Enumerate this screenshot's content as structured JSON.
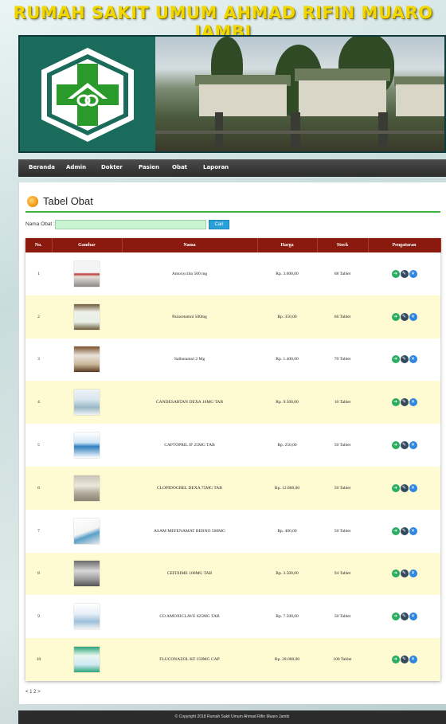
{
  "site": {
    "title": "RUMAH SAKIT UMUM AHMAD RIFIN MUARO JAMBI"
  },
  "nav": {
    "items": [
      "Beranda",
      "Admin",
      "Dokter",
      "Pasien",
      "Obat",
      "Laporan"
    ]
  },
  "page": {
    "section_title": "Tabel Obat"
  },
  "search": {
    "label": "Nama Obat :",
    "value": "",
    "button_label": "Cari"
  },
  "table": {
    "headers": [
      "No.",
      "Gambar",
      "Nama",
      "Harga",
      "Stock",
      "Pengaturan"
    ],
    "rows": [
      {
        "no": "1",
        "nama": "Amoxycilin 500 mg",
        "harga": "Rp. 3.000,00",
        "stock": "68 Tablet"
      },
      {
        "no": "2",
        "nama": "Paracetamol 500mg",
        "harga": "Rp. 350,00",
        "stock": "66 Tablet"
      },
      {
        "no": "3",
        "nama": "Salbutamol 2 Mg",
        "harga": "Rp. 1.400,00",
        "stock": "70 Tablet"
      },
      {
        "no": "4",
        "nama": "CANDESARTAN DEXA 16MG TAB",
        "harga": "Rp. 9.500,00",
        "stock": "10 Tablet"
      },
      {
        "no": "5",
        "nama": "CAPTOPRIL IF 25MG TAB",
        "harga": "Rp. 250,00",
        "stock": "50 Tablet"
      },
      {
        "no": "6",
        "nama": "CLOPIDOGREL DEXA 75MG TAB",
        "harga": "Rp. 12.800,00",
        "stock": "50 Tablet"
      },
      {
        "no": "7",
        "nama": "ASAM MEFENAMAT BERNO 500MG",
        "harga": "Rp. 400,00",
        "stock": "50 Tablet"
      },
      {
        "no": "8",
        "nama": "CEFIXIME 100MG TAB",
        "harga": "Rp. 3.500,00",
        "stock": "94 Tablet"
      },
      {
        "no": "9",
        "nama": "CO AMOXICLAVE 625MG TAB",
        "harga": "Rp. 7.500,00",
        "stock": "50 Tablet"
      },
      {
        "no": "10",
        "nama": "FLUCONAZOL KF 150MG CAP",
        "harga": "Rp. 28.000,00",
        "stock": "100 Tablet"
      }
    ],
    "action_icons": [
      "view-icon",
      "edit-icon",
      "delete-icon"
    ]
  },
  "pagination": {
    "text": "< 1 2 >"
  },
  "footer": {
    "text": "© Copyright 2018 Rumah Sakit Umum Ahmad Rifin Muaro Jambi"
  },
  "colors": {
    "title_yellow": "#f2d600",
    "header_red": "#8b1a0e",
    "row_alt": "#fefbd3",
    "accent_green": "#3cb043",
    "button_blue": "#2aa0d8"
  }
}
